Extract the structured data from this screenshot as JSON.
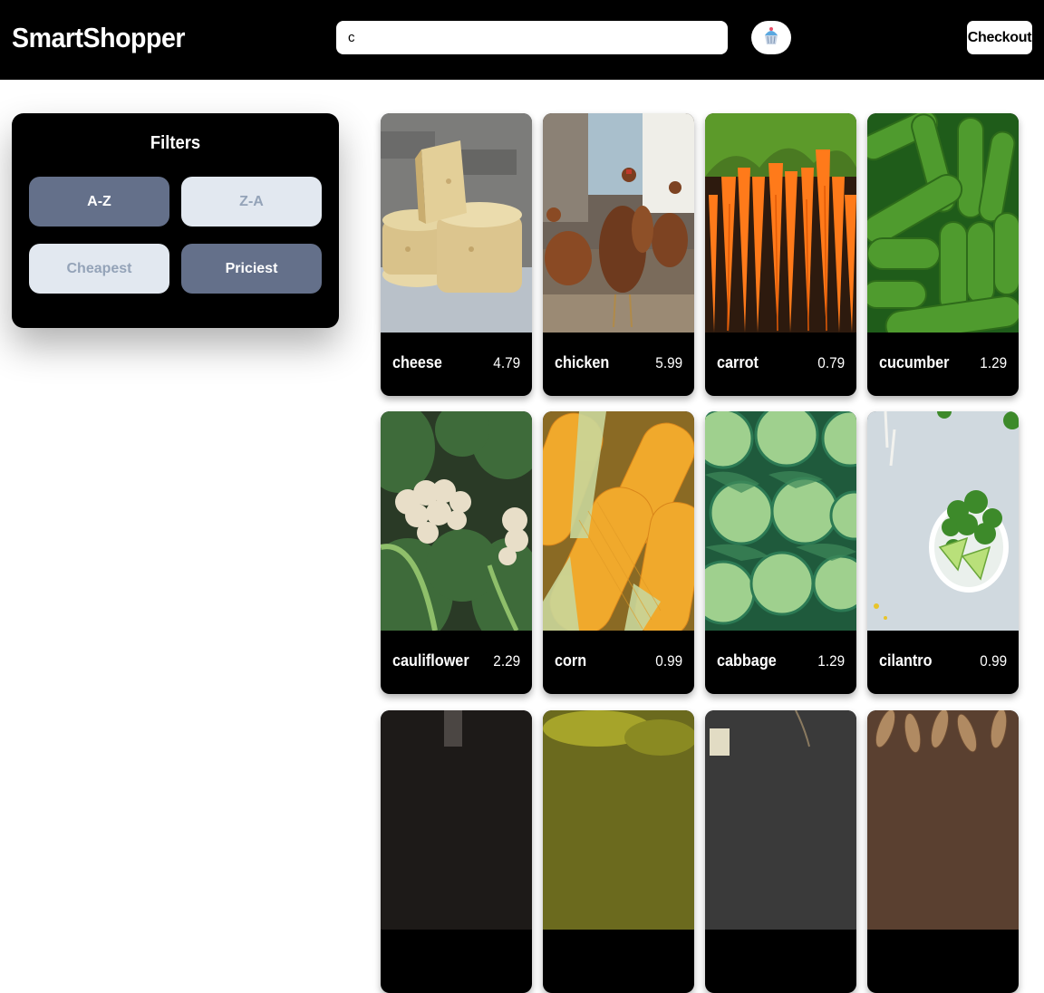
{
  "header": {
    "logo": "SmartShopper",
    "search_value": "c",
    "cart_icon": "cupcake-icon",
    "checkout_label": "Checkout"
  },
  "filters": {
    "title": "Filters",
    "buttons": [
      {
        "label": "A-Z",
        "active": true
      },
      {
        "label": "Z-A",
        "active": false
      },
      {
        "label": "Cheapest",
        "active": false
      },
      {
        "label": "Priciest",
        "active": true
      }
    ]
  },
  "products": [
    {
      "name": "cheese",
      "price": "4.79"
    },
    {
      "name": "chicken",
      "price": "5.99"
    },
    {
      "name": "carrot",
      "price": "0.79"
    },
    {
      "name": "cucumber",
      "price": "1.29"
    },
    {
      "name": "cauliflower",
      "price": "2.29"
    },
    {
      "name": "corn",
      "price": "0.99"
    },
    {
      "name": "cabbage",
      "price": "1.29"
    },
    {
      "name": "cilantro",
      "price": "0.99"
    }
  ],
  "colors": {
    "header_bg": "#000000",
    "filter_active": "#64708a",
    "filter_inactive": "#e2e8f0",
    "filter_inactive_text": "#94a3b8"
  }
}
